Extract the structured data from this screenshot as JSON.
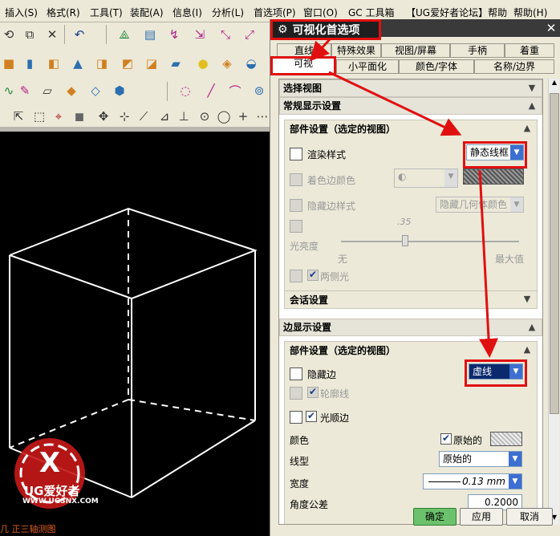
{
  "menubar": {
    "items": [
      "插入(S)",
      "格式(R)",
      "工具(T)",
      "装配(A)",
      "信息(I)",
      "分析(L)",
      "首选项(P)",
      "窗口(O)",
      "GC 工具箱",
      "【UG爱好者论坛】帮助",
      "帮助(H)"
    ]
  },
  "toolbars": {
    "icons": [
      "view-rotate-icon",
      "fit-icon",
      "close-icon",
      "undo-icon",
      "wcs-icon",
      "layer-icon",
      "sketch-icon",
      "datum-icon",
      "point-icon",
      "box-icon",
      "cylinder-icon",
      "cone-icon",
      "sphere-icon",
      "extrude-icon",
      "revolve-icon",
      "line-icon",
      "arc-icon",
      "spline-icon",
      "select-icon",
      "snap-icon"
    ]
  },
  "viewport": {
    "view_label": "几 正三轴测图",
    "logo_text": "UG爱好者",
    "logo_url": "WWW.UGSNX.COM"
  },
  "dialog": {
    "title": "可视化首选项",
    "tabs_row1": [
      "直线",
      "特殊效果",
      "视图/屏幕",
      "手柄",
      "着重"
    ],
    "tabs_row2": [
      "可视",
      "小平面化",
      "颜色/字体",
      "名称/边界"
    ],
    "active_tab": "可视",
    "sections": {
      "select_view": "选择视图",
      "general_display": "常规显示设置",
      "part_settings": "部件设置（选定的视图）",
      "render_style_label": "渲染样式",
      "render_style_value": "静态线框",
      "shaded_edge_color": "着色边颜色",
      "hidden_edge_style": "隐藏边样式",
      "hidden_edge_value": "隐藏几何体颜色",
      "light_brightness": "光亮度",
      "slider_value": ".35",
      "slider_min": "无",
      "slider_max": "最大值",
      "two_sided_light": "两侧光",
      "session_settings": "会话设置",
      "edge_display": "边显示设置",
      "part_settings2": "部件设置（选定的视图）",
      "hidden_edges": "隐藏边",
      "hidden_edges_value": "虚线",
      "silhouettes": "轮廓线",
      "smooth_edges": "光顺边",
      "color_label": "颜色",
      "original_label": "原始的",
      "linetype_label": "线型",
      "linetype_value": "原始的",
      "width_label": "宽度",
      "width_value": "0.13 mm",
      "angle_tol_label": "角度公差",
      "angle_tol_value": "0.2000"
    },
    "buttons": {
      "ok": "确定",
      "apply": "应用",
      "cancel": "取消"
    }
  },
  "colors": {
    "highlight": "#e01010",
    "viewport_bg": "#000000",
    "title_bg": "#1f1f1f"
  }
}
